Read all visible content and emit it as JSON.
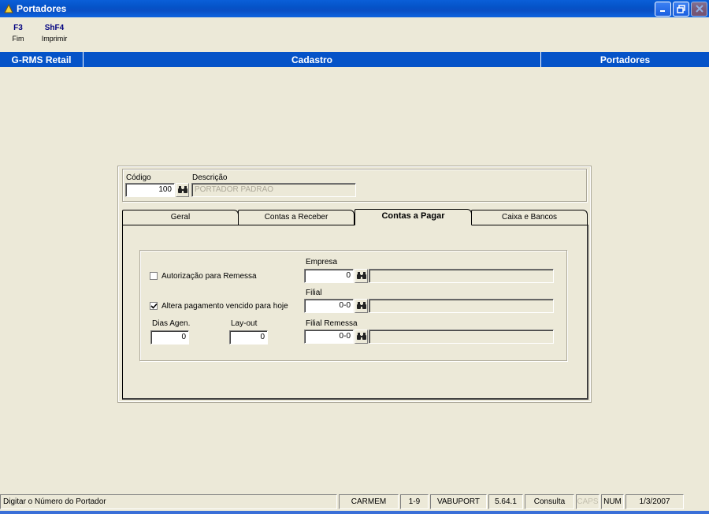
{
  "window": {
    "title": "Portadores"
  },
  "fkeys": [
    {
      "key": "F3",
      "label": "Fim"
    },
    {
      "key": "ShF4",
      "label": "Imprimir"
    }
  ],
  "bluebar": {
    "app": "G-RMS Retail",
    "section": "Cadastro",
    "module": "Portadores"
  },
  "form": {
    "codigo_label": "Código",
    "codigo_value": "100",
    "descricao_label": "Descrição",
    "descricao_value": "PORTADOR PADRAO"
  },
  "tabs": [
    {
      "label": "Geral",
      "active": false
    },
    {
      "label": "Contas a Receber",
      "active": false
    },
    {
      "label": "Contas a Pagar",
      "active": true
    },
    {
      "label": "Caixa e Bancos",
      "active": false
    }
  ],
  "pagar": {
    "autorizacao_label": "Autorização para Remessa",
    "autorizacao_checked": false,
    "altera_label": "Altera pagamento vencido para hoje",
    "altera_checked": true,
    "dias_label": "Dias Agen.",
    "dias_value": "0",
    "layout_label": "Lay-out",
    "layout_value": "0",
    "empresa_label": "Empresa",
    "empresa_value": "0",
    "filial_label": "Filial",
    "filial_value": "0-0",
    "filial_remessa_label": "Filial Remessa",
    "filial_remessa_value": "0-0"
  },
  "status": {
    "message": "Digitar o Número do Portador",
    "user": "CARMEM",
    "code": "1-9",
    "program": "VABUPORT",
    "version": "5.64.1",
    "mode": "Consulta",
    "caps": "CAPS",
    "num": "NUM",
    "date": "1/3/2007"
  },
  "icons": {
    "app": "app-icon",
    "search": "binoculars-icon"
  }
}
